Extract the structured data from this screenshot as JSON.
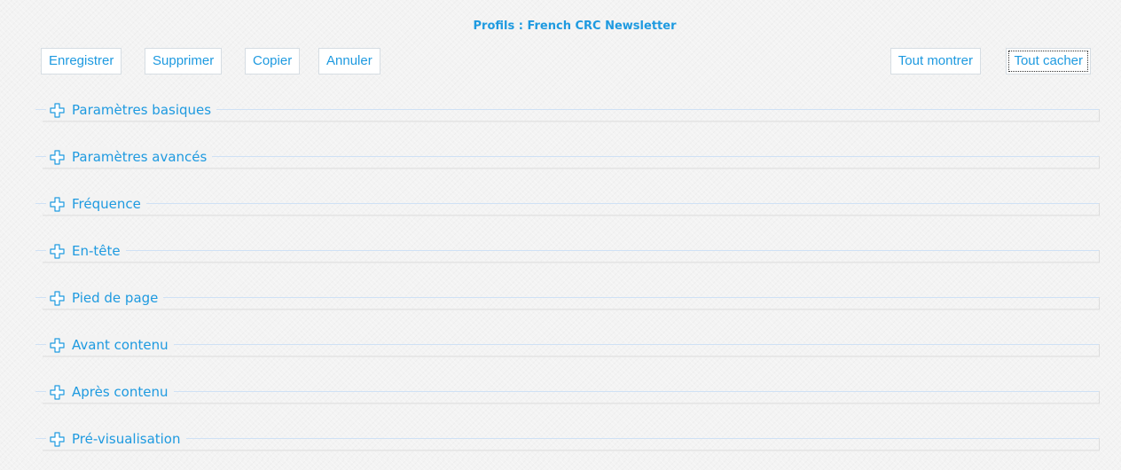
{
  "page_title": "Profils : French CRC Newsletter",
  "toolbar": {
    "save_label": "Enregistrer",
    "delete_label": "Supprimer",
    "copy_label": "Copier",
    "cancel_label": "Annuler",
    "show_all_label": "Tout montrer",
    "hide_all_label": "Tout cacher"
  },
  "sections": [
    {
      "label": "Paramètres basiques",
      "icon": "plus-expand-icon"
    },
    {
      "label": "Paramètres avancés",
      "icon": "plus-expand-icon"
    },
    {
      "label": "Fréquence",
      "icon": "plus-expand-icon"
    },
    {
      "label": "En-tête",
      "icon": "plus-expand-icon"
    },
    {
      "label": "Pied de page",
      "icon": "plus-expand-icon"
    },
    {
      "label": "Avant contenu",
      "icon": "plus-expand-icon"
    },
    {
      "label": "Après contenu",
      "icon": "plus-expand-icon"
    },
    {
      "label": "Pré-visualisation",
      "icon": "plus-expand-icon"
    }
  ],
  "colors": {
    "accent": "#1e9ae0",
    "background": "#f3f3f3",
    "button_border": "#d6dde3"
  }
}
